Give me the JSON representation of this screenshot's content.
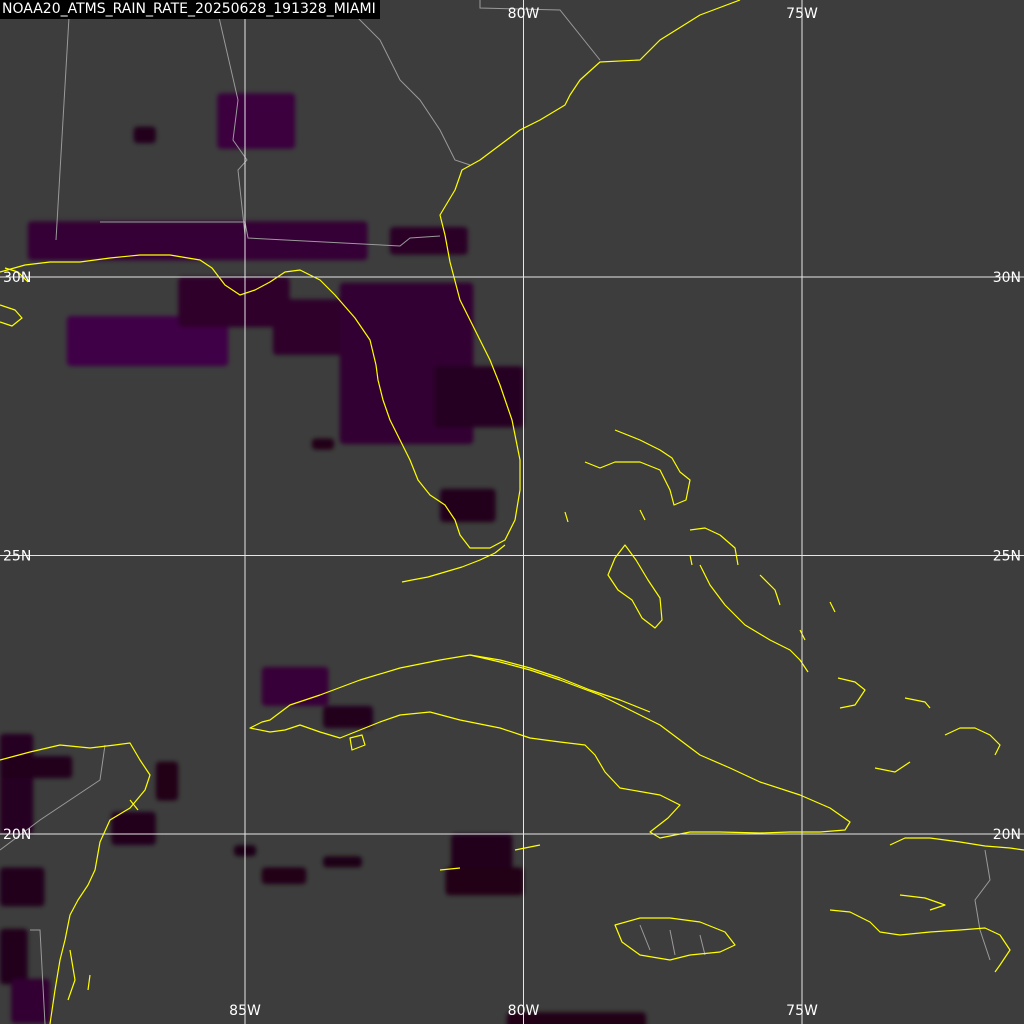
{
  "title": "NOAA20_ATMS_RAIN_RATE_20250628_191328_MIAMI",
  "colors": {
    "background": "#3d3d3d",
    "coastline": "#ffff00",
    "borders": "#9a9a9a",
    "gridlines": "#e6e6e6",
    "rain_low": "#1a0010",
    "rain_high": "#5a0a6a",
    "label_text": "#ffffff"
  },
  "gridlines": {
    "longitudes": [
      {
        "value": -85,
        "top_label": "",
        "bottom_label": "85W"
      },
      {
        "value": -80,
        "top_label": "80W",
        "bottom_label": "80W"
      },
      {
        "value": -75,
        "top_label": "75W",
        "bottom_label": "75W"
      }
    ],
    "latitudes": [
      {
        "value": 30,
        "left_label": "30N",
        "right_label": "30N"
      },
      {
        "value": 25,
        "left_label": "25N",
        "right_label": "25N"
      },
      {
        "value": 20,
        "left_label": "20N",
        "right_label": "20N"
      }
    ]
  },
  "rain_cells": [
    {
      "lon0": -88.1,
      "lon1": -87.8,
      "lat0": 34.7,
      "lat1": 35.0,
      "intensity": 0.1
    },
    {
      "lon0": -85.5,
      "lon1": -84.1,
      "lat0": 32.3,
      "lat1": 33.3,
      "intensity": 0.5
    },
    {
      "lon0": -87.0,
      "lon1": -86.6,
      "lat0": 32.4,
      "lat1": 32.7,
      "intensity": 0.15
    },
    {
      "lon0": -88.9,
      "lon1": -82.8,
      "lat0": 30.3,
      "lat1": 31.0,
      "intensity": 0.4
    },
    {
      "lon0": -82.4,
      "lon1": -81.0,
      "lat0": 30.4,
      "lat1": 30.9,
      "intensity": 0.25
    },
    {
      "lon0": -88.2,
      "lon1": -85.3,
      "lat0": 28.4,
      "lat1": 29.3,
      "intensity": 0.6
    },
    {
      "lon0": -86.2,
      "lon1": -84.2,
      "lat0": 29.1,
      "lat1": 30.0,
      "intensity": 0.3
    },
    {
      "lon0": -84.5,
      "lon1": -81.2,
      "lat0": 28.6,
      "lat1": 29.6,
      "intensity": 0.3
    },
    {
      "lon0": -83.3,
      "lon1": -80.9,
      "lat0": 27.0,
      "lat1": 29.9,
      "intensity": 0.35
    },
    {
      "lon0": -81.6,
      "lon1": -80.0,
      "lat0": 27.3,
      "lat1": 28.4,
      "intensity": 0.2
    },
    {
      "lon0": -81.5,
      "lon1": -80.5,
      "lat0": 25.6,
      "lat1": 26.2,
      "intensity": 0.15
    },
    {
      "lon0": -83.8,
      "lon1": -83.4,
      "lat0": 26.9,
      "lat1": 27.1,
      "intensity": 0.1
    },
    {
      "lon0": -84.7,
      "lon1": -83.5,
      "lat0": 22.3,
      "lat1": 23.0,
      "intensity": 0.45
    },
    {
      "lon0": -83.6,
      "lon1": -82.7,
      "lat0": 21.9,
      "lat1": 22.3,
      "intensity": 0.15
    },
    {
      "lon0": -89.4,
      "lon1": -88.8,
      "lat0": 20.0,
      "lat1": 21.8,
      "intensity": 0.2
    },
    {
      "lon0": -89.4,
      "lon1": -88.1,
      "lat0": 21.0,
      "lat1": 21.4,
      "intensity": 0.15
    },
    {
      "lon0": -86.6,
      "lon1": -86.2,
      "lat0": 20.6,
      "lat1": 21.3,
      "intensity": 0.1
    },
    {
      "lon0": -87.4,
      "lon1": -86.6,
      "lat0": 19.8,
      "lat1": 20.4,
      "intensity": 0.12
    },
    {
      "lon0": -85.2,
      "lon1": -84.8,
      "lat0": 19.6,
      "lat1": 19.8,
      "intensity": 0.08
    },
    {
      "lon0": -84.7,
      "lon1": -83.9,
      "lat0": 19.1,
      "lat1": 19.4,
      "intensity": 0.1
    },
    {
      "lon0": -83.6,
      "lon1": -82.9,
      "lat0": 19.4,
      "lat1": 19.6,
      "intensity": 0.08
    },
    {
      "lon0": -81.3,
      "lon1": -80.2,
      "lat0": 19.3,
      "lat1": 20.0,
      "intensity": 0.12
    },
    {
      "lon0": -81.4,
      "lon1": -80.0,
      "lat0": 18.9,
      "lat1": 19.4,
      "intensity": 0.1
    },
    {
      "lon0": -89.4,
      "lon1": -88.6,
      "lat0": 18.7,
      "lat1": 19.4,
      "intensity": 0.15
    },
    {
      "lon0": -89.4,
      "lon1": -88.9,
      "lat0": 17.3,
      "lat1": 18.3,
      "intensity": 0.12
    },
    {
      "lon0": -89.2,
      "lon1": -88.5,
      "lat0": 16.6,
      "lat1": 17.4,
      "intensity": 0.35
    },
    {
      "lon0": -80.3,
      "lon1": -77.8,
      "lat0": 15.7,
      "lat1": 16.8,
      "intensity": 0.1
    }
  ]
}
